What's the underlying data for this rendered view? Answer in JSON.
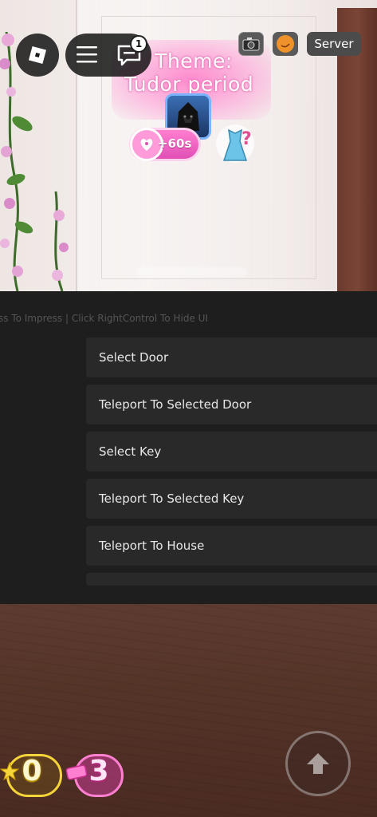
{
  "hud": {
    "chat_badge": "1",
    "server_label": "Server"
  },
  "theme": {
    "line1": "Theme:",
    "line2": "Tudor period",
    "timer": "+60s"
  },
  "panel": {
    "hint": "ss To Impress | Click RightControl To Hide UI",
    "buttons": [
      "Select Door",
      "Teleport To Selected Door",
      "Select Key",
      "Teleport To Selected Key",
      "Teleport To House"
    ]
  },
  "currency": {
    "stars": "0",
    "tickets": "3"
  },
  "colors": {
    "panel_bg": "#1e1e1e",
    "button_bg": "#292929",
    "stars_border": "#f5d43a",
    "tickets_border": "#ff7fd0",
    "theme_pink": "#ff78c8"
  }
}
